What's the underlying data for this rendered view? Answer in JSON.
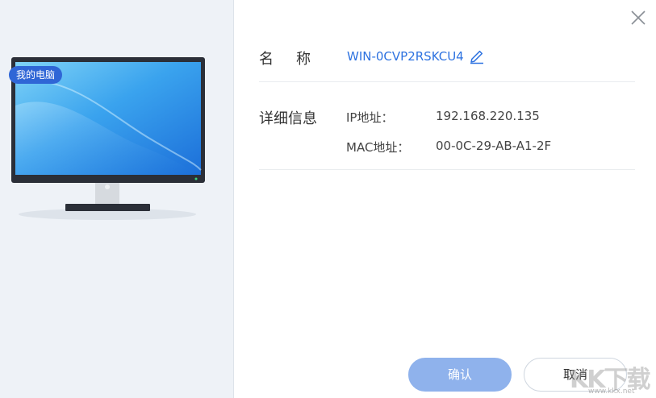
{
  "device": {
    "tag": "我的电脑"
  },
  "fields": {
    "name_label": "名称",
    "name_value": "WIN-0CVP2RSKCU4",
    "detail_label": "详细信息",
    "ip_key": "IP地址：",
    "ip_value": "192.168.220.135",
    "mac_key": "MAC地址：",
    "mac_value": "00-0C-29-AB-A1-2F"
  },
  "buttons": {
    "confirm": "确认",
    "cancel": "取消"
  },
  "watermark": {
    "logo": "KK下载",
    "url": "www.kkx.net"
  },
  "colors": {
    "accent": "#2d72e0",
    "confirm_bg": "#8fb2ec",
    "panel_bg": "#eef2f7"
  },
  "icons": {
    "close": "close-icon",
    "edit": "edit-icon",
    "monitor": "monitor-icon"
  }
}
